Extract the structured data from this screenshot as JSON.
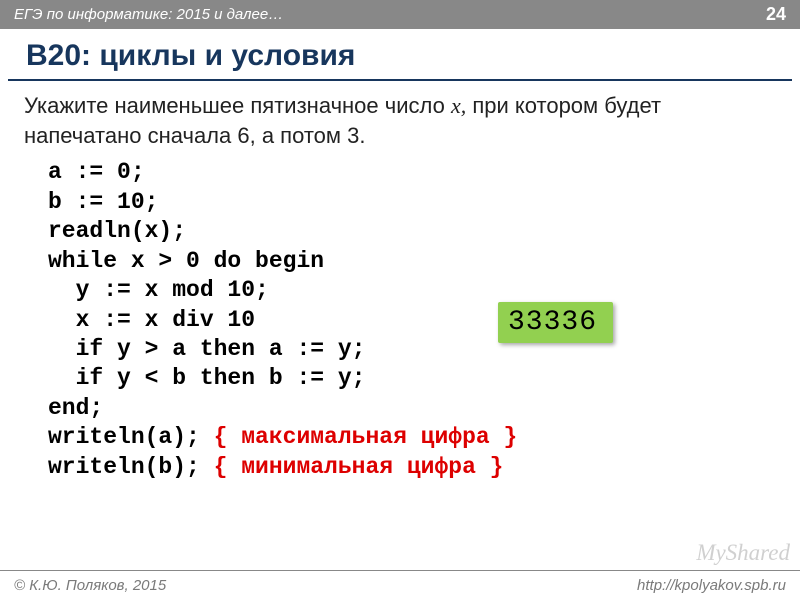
{
  "header": {
    "title": "ЕГЭ по информатике: 2015 и далее…",
    "page_num": "24"
  },
  "heading": "B20: циклы и условия",
  "task": {
    "prefix": "Укажите наименьшее пятизначное число ",
    "var": "x,",
    "suffix": " при котором будет напечатано сначала 6, а потом 3."
  },
  "code": {
    "l1": "a := 0;",
    "l2": "b := 10;",
    "l3": "readln(x);",
    "l4": "while x > 0 do begin",
    "l5": "  y := x mod 10;",
    "l6": "  x := x div 10",
    "l7": "  if y > a then a := y;",
    "l8": "  if y < b then b := y;",
    "l9": "end;",
    "l10a": "writeln(a); ",
    "l10b": "{ максимальная цифра }",
    "l11a": "writeln(b); ",
    "l11b": "{ минимальная цифра }"
  },
  "answer": "33336",
  "footer": {
    "left": "© К.Ю. Поляков, 2015",
    "right": "http://kpolyakov.spb.ru"
  },
  "watermark": "MyShared"
}
